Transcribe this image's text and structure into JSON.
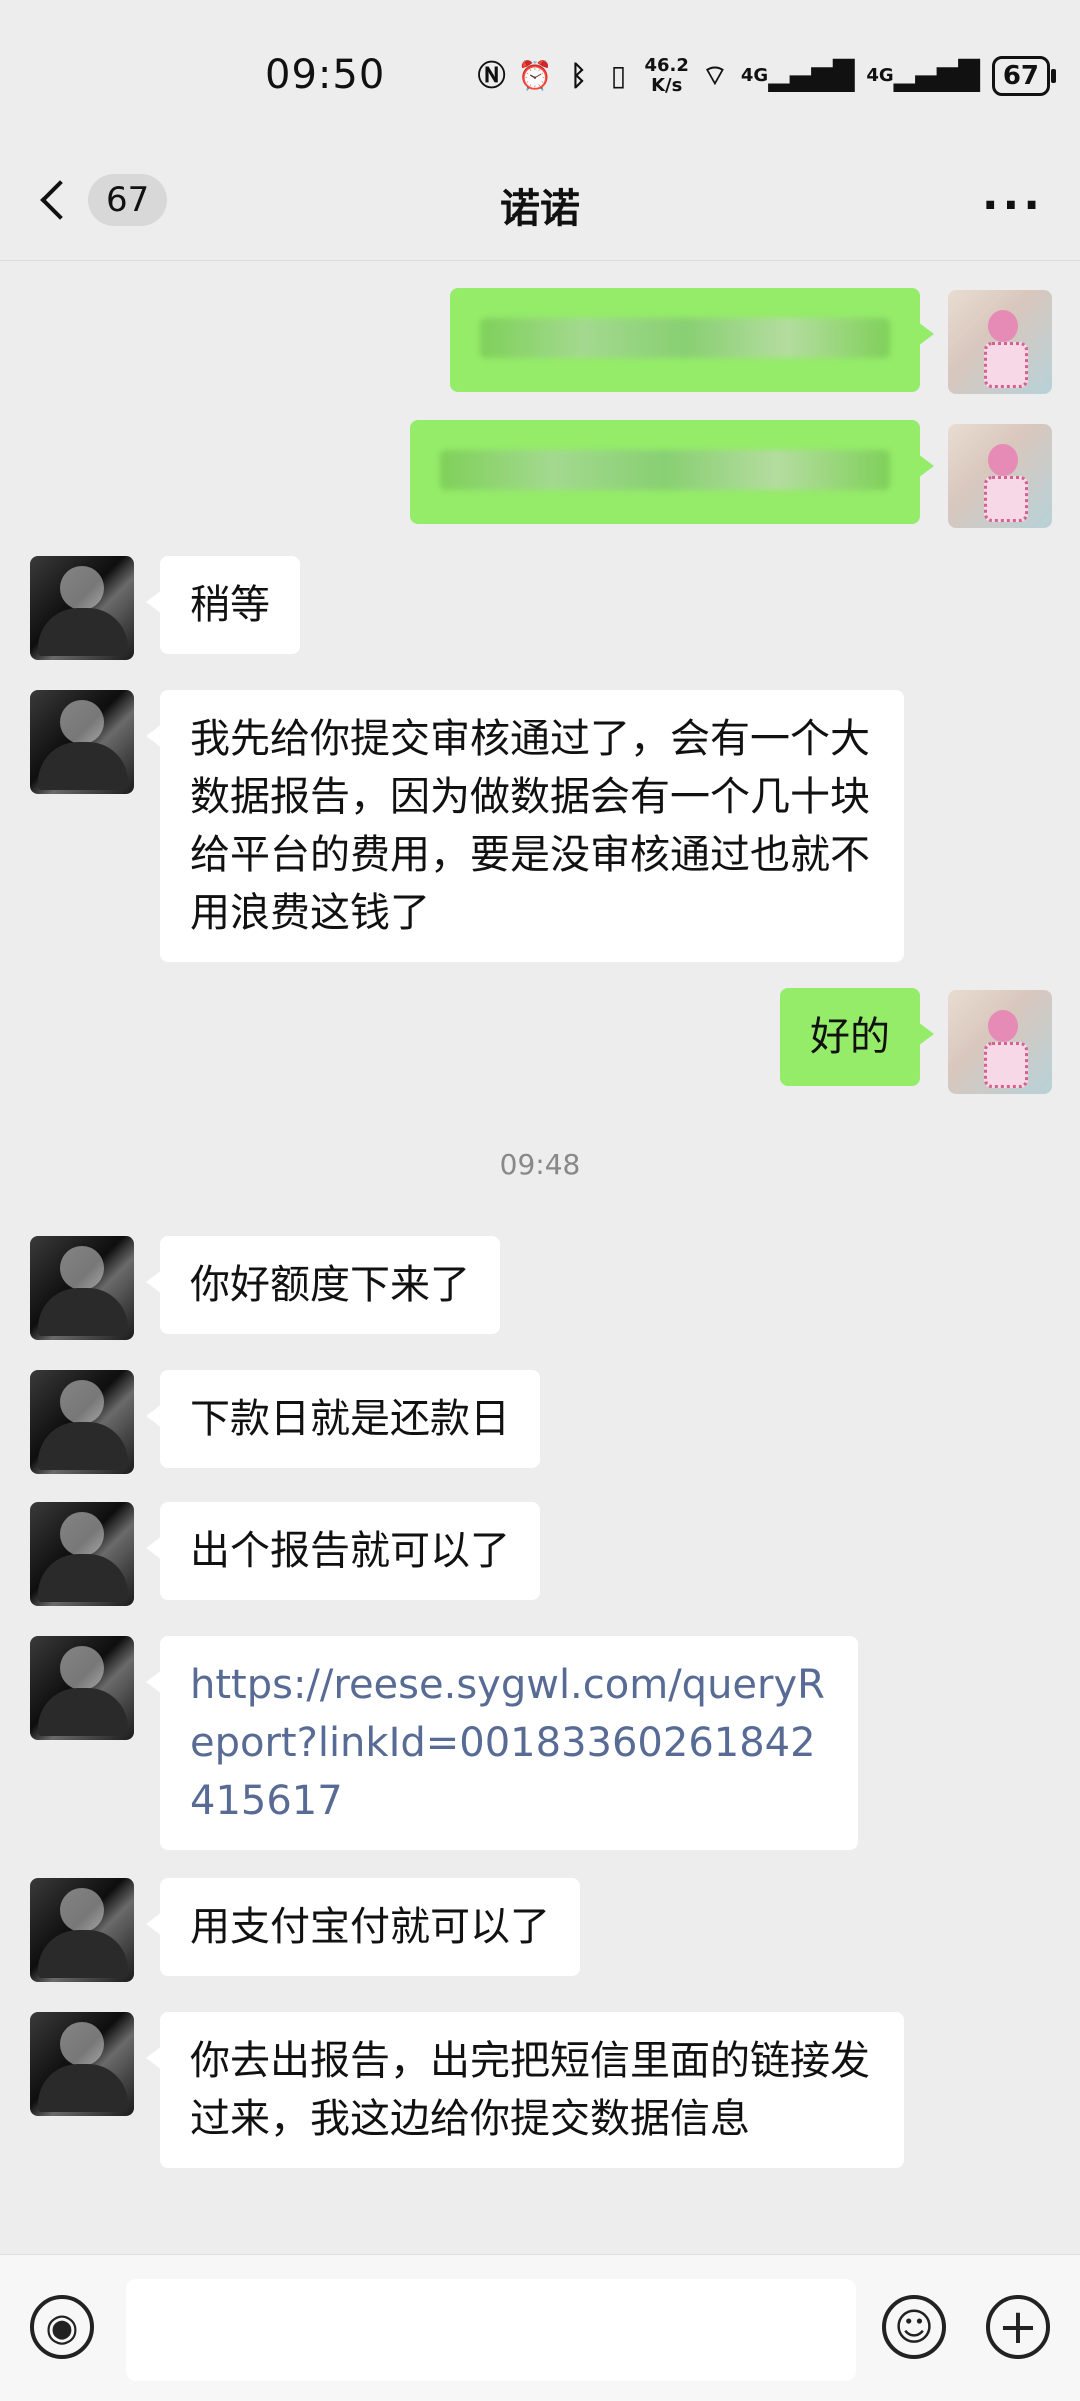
{
  "status_bar": {
    "time": "09:50",
    "net_speed_value": "46.2",
    "net_speed_unit": "K/s",
    "signal1": "4G",
    "signal2": "4G",
    "battery": "67"
  },
  "header": {
    "unread_count": "67",
    "title": "诺诺",
    "more": "···"
  },
  "messages": [
    {
      "id": "m1",
      "sender": "me",
      "text": "",
      "blurred": true
    },
    {
      "id": "m2",
      "sender": "me",
      "text": "",
      "blurred": true
    },
    {
      "id": "m3",
      "sender": "other",
      "text": "稍等"
    },
    {
      "id": "m4",
      "sender": "other",
      "text": "我先给你提交审核通过了，会有一个大数据报告，因为做数据会有一个几十块给平台的费用，要是没审核通过也就不用浪费这钱了"
    },
    {
      "id": "m5",
      "sender": "me",
      "text": "好的"
    },
    {
      "id": "m6",
      "sender": "other",
      "text": "你好额度下来了"
    },
    {
      "id": "m7",
      "sender": "other",
      "text": "下款日就是还款日"
    },
    {
      "id": "m8",
      "sender": "other",
      "text": "出个报告就可以了"
    },
    {
      "id": "m9",
      "sender": "other",
      "text": "https://reese.sygwl.com/queryReport?linkId=0018336026184241561​7",
      "is_link": true
    },
    {
      "id": "m10",
      "sender": "other",
      "text": "用支付宝付就可以了"
    },
    {
      "id": "m11",
      "sender": "other",
      "text": "你去出报告，出完把短信里面的链接发过来，我这边给你提交数据信息"
    }
  ],
  "timestamp": "09:48",
  "input_bar": {
    "placeholder": ""
  },
  "icons": [
    "nfc-icon",
    "alarm-icon",
    "bluetooth-icon",
    "vibrate-icon",
    "wifi-icon",
    "signal-icon",
    "battery-icon",
    "back-icon",
    "more-icon",
    "voice-icon",
    "emoji-icon",
    "plus-icon"
  ]
}
